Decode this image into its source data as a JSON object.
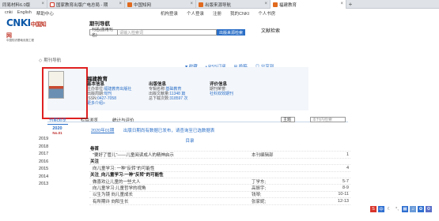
{
  "browser": {
    "tabs": [
      {
        "label": "同易材料6.0版",
        "fav": ""
      },
      {
        "label": "国家教育出版广电总局 - 期",
        "fav": "#d13b2a"
      },
      {
        "label": "中国知网",
        "fav": "#e06a1e"
      },
      {
        "label": "出版来源导航",
        "fav": "#e06a1e"
      },
      {
        "label": "福建教育",
        "fav": "#e06a1e"
      }
    ],
    "new_tab": "+"
  },
  "topnav": {
    "left": [
      "cnki",
      "English",
      "帮助中心"
    ],
    "right": [
      "机构登录",
      "个人登录",
      "注册",
      "我的CNKI",
      "个人书房"
    ]
  },
  "logo": {
    "brand": "CNKI",
    "brand_cn": "中国知网",
    "sub": "中国知识基础设施工程"
  },
  "search": {
    "title": "期刊导航",
    "select": "刊名(曾用刊名)",
    "placeholder": "请输入检索词",
    "button": "出版来源检索",
    "advanced": "文献检索"
  },
  "breadcrumb": "期刊导航",
  "toolbar": [
    "♥ 收藏",
    "• RSS订阅",
    "⊞ 投稿",
    "◎ 分享到"
  ],
  "journal": {
    "title": "福建教育",
    "basic": {
      "heading": "基本信息",
      "rows": [
        {
          "k": "主办单位:",
          "v": "福建教育出版社"
        },
        {
          "k": "出版周期:",
          "v": "旬刊"
        },
        {
          "k": "ISSN:",
          "v": "0427-7058"
        }
      ],
      "more": "更多介绍»"
    },
    "publish": {
      "heading": "出版信息",
      "rows": [
        {
          "k": "专辑名称:",
          "v": "基础教育"
        },
        {
          "k": "出版文献量:",
          "v": "11348 篇"
        },
        {
          "k": "总下载次数:",
          "v": "318597 次"
        }
      ]
    },
    "eval": {
      "heading": "评价信息",
      "rows": [
        {
          "k": "期刊荣誉:",
          "v": ""
        },
        {
          "k": "",
          "v": "社科双效期刊"
        }
      ]
    }
  },
  "content_tabs": [
    "刊期浏览",
    "栏目浏览",
    "统计与评价"
  ],
  "topic_select": "主题",
  "inner_search_placeholder": "本刊内检索",
  "years": [
    {
      "year": "2020",
      "no": "No.01"
    },
    {
      "year": "2019"
    },
    {
      "year": "2018"
    },
    {
      "year": "2017"
    },
    {
      "year": "2016"
    },
    {
      "year": "2015"
    },
    {
      "year": "2014"
    },
    {
      "year": "2013"
    }
  ],
  "issue": {
    "label": "2020年01期",
    "note": "出版日期尚有数据已发布，请查询至已选数据表"
  },
  "toc_label": "目录",
  "articles": [
    {
      "title": "卷首",
      "author": "",
      "pages": "",
      "section": true
    },
    {
      "title": "\"要好了管儿\"——儿童阅读成人的精神启示",
      "author": "本刊编辑部",
      "pages": "1",
      "section": false
    },
    {
      "title": "关注",
      "author": "",
      "pages": "",
      "section": true
    },
    {
      "title": "向儿童学习: 一种\"反转\"的可能性",
      "author": "",
      "pages": "4",
      "section": false
    },
    {
      "title": "关注_向儿童学习:一种\"反转\"的可能性",
      "author": "",
      "pages": "",
      "section": true
    },
    {
      "title": "做喜欢让儿童的一些大人",
      "author": "丁学东;",
      "pages": "5-7",
      "section": false
    },
    {
      "title": "向儿童学习:儿童哲学的视角",
      "author": "高振宇;",
      "pages": "8-9",
      "section": false
    },
    {
      "title": "以生为镜 向儿童成长",
      "author": "钱琴;",
      "pages": "10-11",
      "section": false
    },
    {
      "title": "有所期许 向阳生长",
      "author": "张家妮;",
      "pages": "12-13",
      "section": false
    }
  ]
}
